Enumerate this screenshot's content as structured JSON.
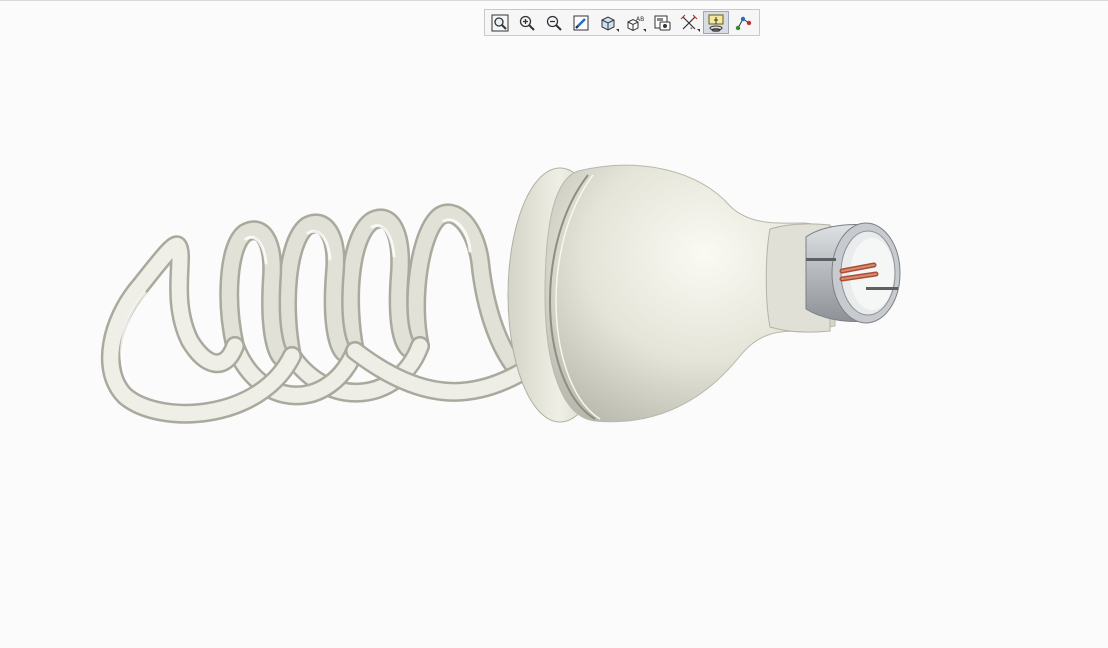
{
  "toolbar": {
    "buttons": [
      {
        "icon": "zoom-fit-icon",
        "has_menu": false,
        "active": false
      },
      {
        "icon": "zoom-in-icon",
        "has_menu": false,
        "active": false
      },
      {
        "icon": "zoom-out-icon",
        "has_menu": false,
        "active": false
      },
      {
        "icon": "repaint-icon",
        "has_menu": false,
        "active": false
      },
      {
        "icon": "display-style-icon",
        "has_menu": true,
        "active": false
      },
      {
        "icon": "saved-views-icon",
        "has_menu": true,
        "active": false
      },
      {
        "icon": "view-manager-icon",
        "has_menu": false,
        "active": false
      },
      {
        "icon": "datum-display-icon",
        "has_menu": true,
        "active": false
      },
      {
        "icon": "spin-center-icon",
        "has_menu": false,
        "active": true
      },
      {
        "icon": "annotation-display-icon",
        "has_menu": false,
        "active": false
      }
    ],
    "saved_views_label": "AB"
  },
  "colors": {
    "background": "#fbfbfb",
    "model_body": "#e6e6dc",
    "connector_metal": "#b4b8bc",
    "wire_copper": "#c8674c"
  }
}
